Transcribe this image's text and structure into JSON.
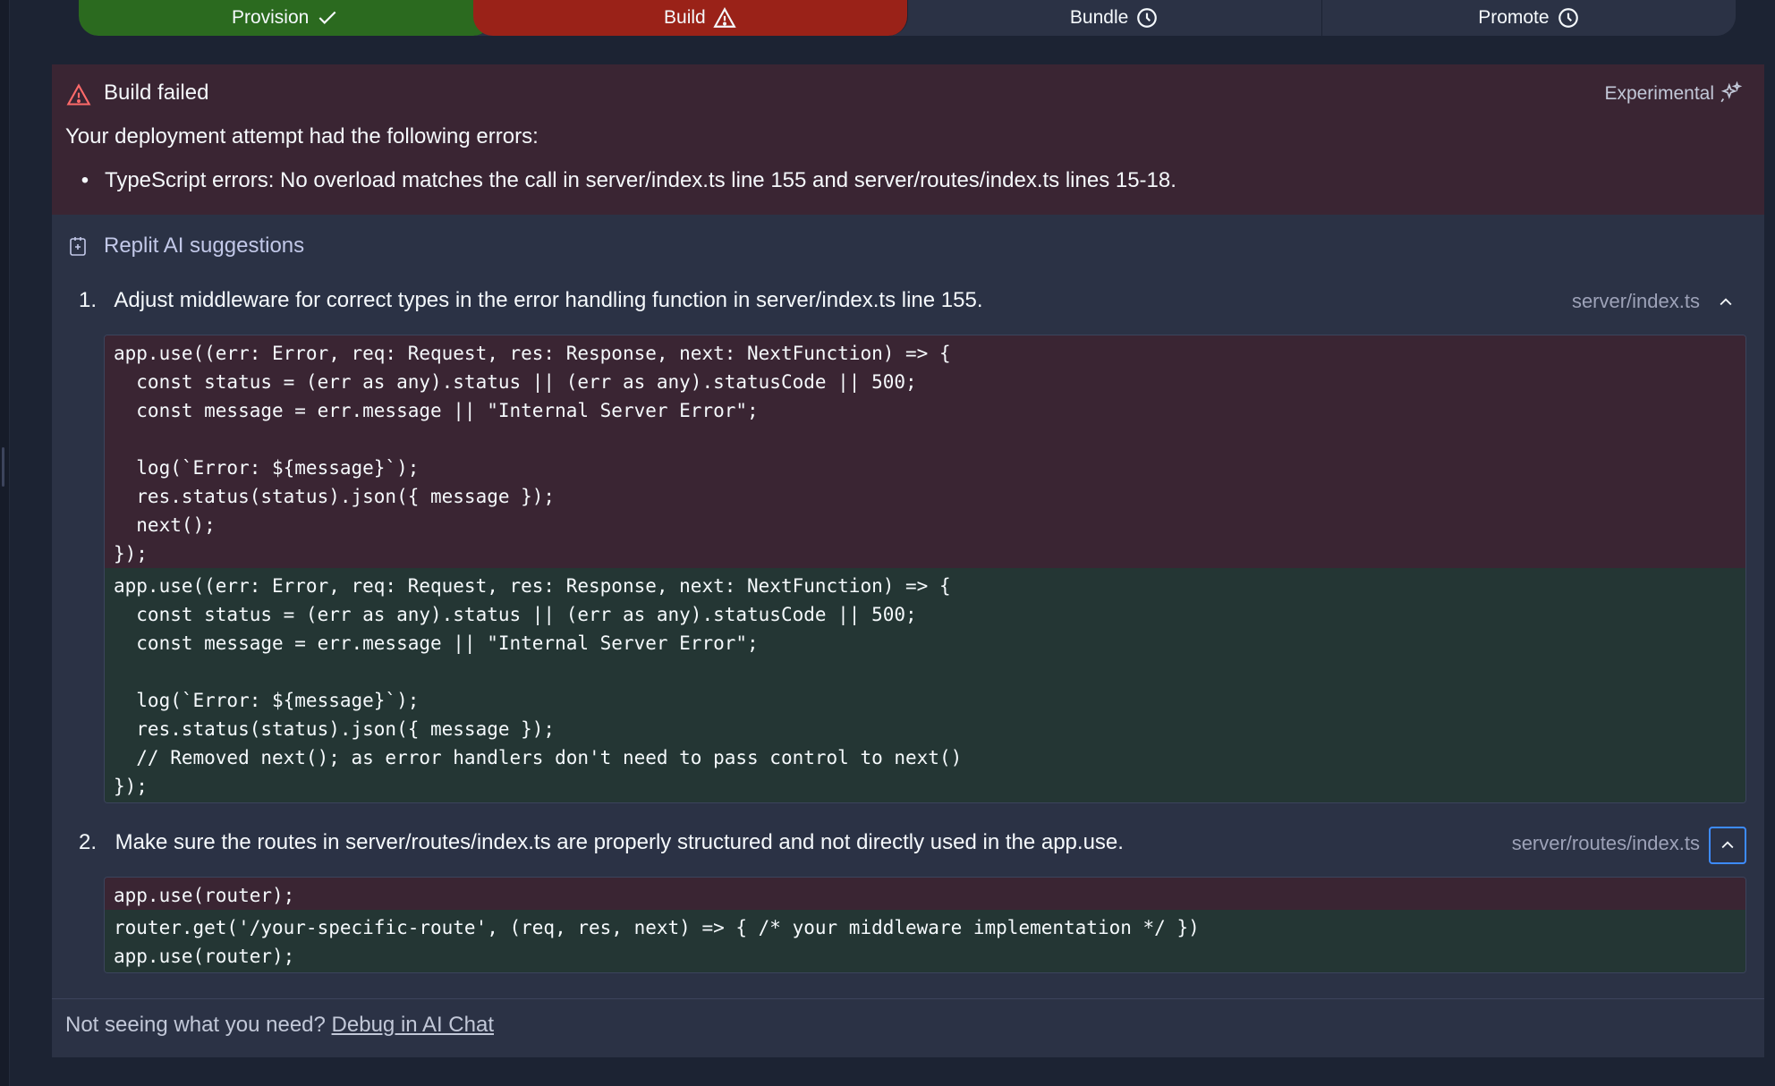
{
  "stepper": {
    "steps": [
      {
        "label": "Provision",
        "icon": "check-icon",
        "status": "success"
      },
      {
        "label": "Build",
        "icon": "warning-icon",
        "status": "failed"
      },
      {
        "label": "Bundle",
        "icon": "clock-icon",
        "status": "pending"
      },
      {
        "label": "Promote",
        "icon": "clock-icon",
        "status": "pending"
      }
    ]
  },
  "error": {
    "title": "Build failed",
    "badge": "Experimental",
    "description": "Your deployment attempt had the following errors:",
    "items": [
      "TypeScript errors: No overload matches the call in server/index.ts line 155 and server/routes/index.ts lines 15-18."
    ]
  },
  "suggestions": {
    "title": "Replit AI suggestions",
    "items": [
      {
        "number": "1.",
        "text": "Adjust middleware for correct types in the error handling function in server/index.ts line 155.",
        "file": "server/index.ts",
        "removed": [
          "app.use((err: Error, req: Request, res: Response, next: NextFunction) => {",
          "  const status = (err as any).status || (err as any).statusCode || 500;",
          "  const message = err.message || \"Internal Server Error\";",
          "",
          "  log(`Error: ${message}`);",
          "  res.status(status).json({ message });",
          "  next();",
          "});"
        ],
        "added": [
          "app.use((err: Error, req: Request, res: Response, next: NextFunction) => {",
          "  const status = (err as any).status || (err as any).statusCode || 500;",
          "  const message = err.message || \"Internal Server Error\";",
          "",
          "  log(`Error: ${message}`);",
          "  res.status(status).json({ message });",
          "  // Removed next(); as error handlers don't need to pass control to next()",
          "});"
        ]
      },
      {
        "number": "2.",
        "text": "Make sure the routes in server/routes/index.ts are properly structured and not directly used in the app.use.",
        "file": "server/routes/index.ts",
        "removed": [
          "app.use(router);"
        ],
        "added": [
          "router.get('/your-specific-route', (req, res, next) => { /* your middleware implementation */ })",
          "app.use(router);"
        ]
      }
    ]
  },
  "footer": {
    "prompt": "Not seeing what you need?",
    "link": "Debug in AI Chat"
  },
  "colors": {
    "success": "#2b6a1f",
    "failed": "#9a2218",
    "pending": "#2b3245",
    "error_bg": "#3a2533",
    "added_bg": "#243634",
    "accent": "#3d8bff"
  }
}
